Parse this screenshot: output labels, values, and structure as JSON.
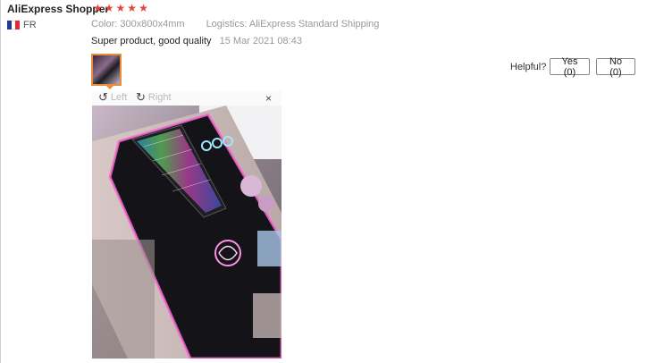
{
  "review": {
    "reviewer": "AliExpress Shopper",
    "rating": 5,
    "country": "FR",
    "color_label": "Color:",
    "color_value": "300x800x4mm",
    "logistics_label": "Logistics:",
    "logistics_value": "AliExpress Standard Shipping",
    "text": "Super product, good quality",
    "date": "15 Mar 2021 08:43"
  },
  "helpful": {
    "label": "Helpful?",
    "yes": "Yes (0)",
    "no": "No (0)"
  },
  "viewer": {
    "rotate_left": "Left",
    "rotate_right": "Right",
    "close": "×"
  },
  "colors": {
    "star": "#e6423c",
    "thumb_border": "#e88d3a",
    "flag_blue": "#1f3b9a",
    "flag_red": "#e02b30"
  },
  "icons": [
    "star-icon",
    "flag-icon",
    "rotate-left-icon",
    "rotate-right-icon",
    "close-icon"
  ]
}
